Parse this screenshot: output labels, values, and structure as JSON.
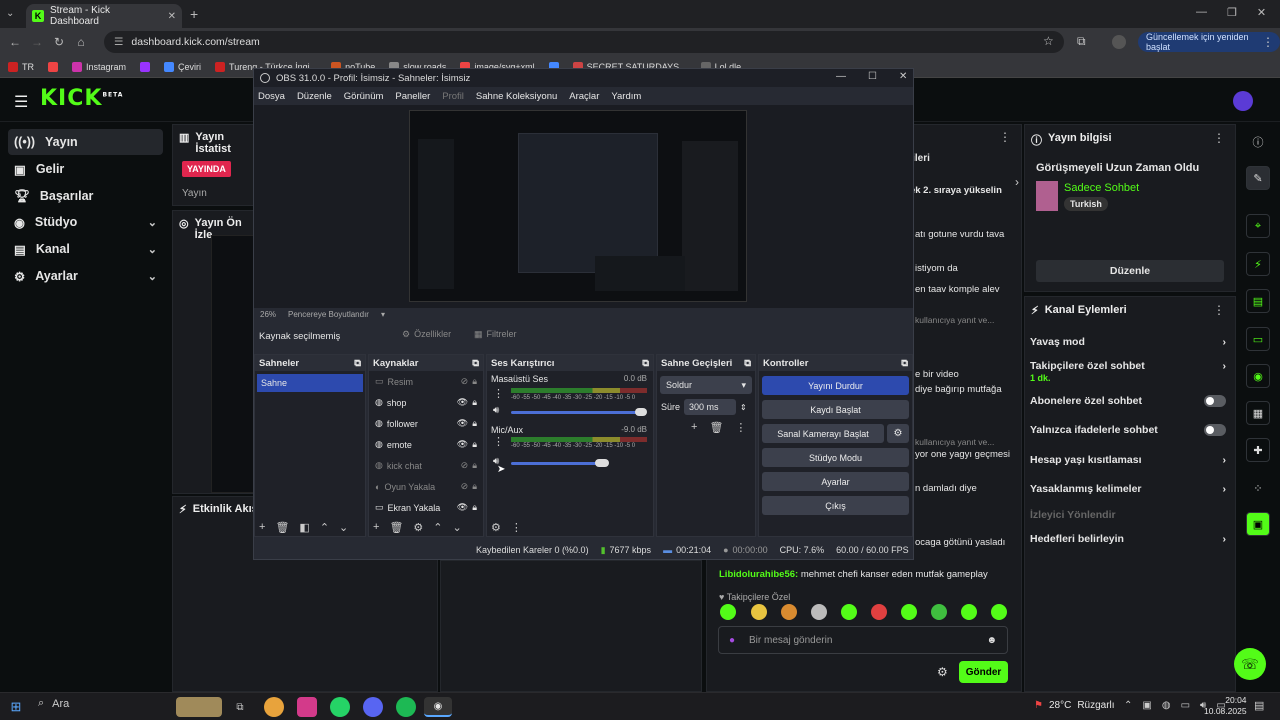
{
  "browser": {
    "tab_title": "Stream - Kick Dashboard",
    "url": "dashboard.kick.com/stream",
    "update_button": "Güncellemek için yeniden başlat",
    "bookmarks": [
      "TR",
      "",
      "Instagram",
      "",
      "Çeviri",
      "Tureng - Türkçe İngi...",
      "noTube",
      "slow roads",
      "image/svg+xml",
      "",
      "SECRET SATURDAYS...",
      "Lol dle"
    ]
  },
  "kick": {
    "logo": "KICK",
    "logo_sup": "BETA",
    "nav": [
      {
        "label": "Yayın",
        "icon": "broadcast-icon"
      },
      {
        "label": "Gelir",
        "icon": "revenue-icon"
      },
      {
        "label": "Başarılar",
        "icon": "trophy-icon"
      },
      {
        "label": "Stüdyo",
        "icon": "studio-icon"
      },
      {
        "label": "Kanal",
        "icon": "channel-icon"
      },
      {
        "label": "Ayarlar",
        "icon": "settings-icon"
      }
    ],
    "stats_panel": {
      "title": "Yayın İstatist",
      "badge": "YAYINDA",
      "label": "Yayın"
    },
    "preview_panel": {
      "title": "Yayın Ön İzle"
    },
    "activity_panel": {
      "title": "Etkinlik Akışı"
    },
    "chat_partial": {
      "header": "ecileri",
      "lines": [
        "erek 2. sıraya yükselin",
        "atı gotune vurdu tava",
        "istiyom da",
        "en taav komple alev",
        "kullanıcıya yanıt ve...",
        "e bir video",
        "diye bağırıp mutfağa",
        "kullanıcıya yanıt ve...",
        "yor one yagyı geçmesi",
        "n damladı diye",
        "ocaga götünü yasladı"
      ],
      "last_user": "Libidolurahibe56:",
      "last_message": "mehmet chefi kanser eden mutfak gameplay",
      "followers_only": "Takipçilere Özel",
      "input_placeholder": "Bir mesaj gönderin",
      "send": "Gönder"
    },
    "stream_info": {
      "title": "Yayın bilgisi",
      "stream_title": "Görüşmeyeli Uzun Zaman Oldu",
      "category": "Sadece Sohbet",
      "language": "Turkish",
      "edit_button": "Düzenle"
    },
    "channel_actions": {
      "title": "Kanal Eylemleri",
      "items": [
        {
          "label": "Yavaş mod",
          "kind": "chevron"
        },
        {
          "label": "Takipçilere özel sohbet",
          "sub": "1 dk.",
          "kind": "chevron"
        },
        {
          "label": "Abonelere özel sohbet",
          "kind": "toggle"
        },
        {
          "label": "Yalnızca ifadelerle sohbet",
          "kind": "toggle"
        },
        {
          "label": "Hesap yaşı kısıtlaması",
          "kind": "chevron"
        },
        {
          "label": "Yasaklanmış kelimeler",
          "kind": "chevron"
        },
        {
          "label": "İzleyici Yönlendir",
          "kind": "disabled"
        },
        {
          "label": "Hedefleri belirleyin",
          "kind": "chevron"
        }
      ]
    }
  },
  "obs": {
    "title": "OBS 31.0.0 - Profil: İsimsiz - Sahneler: İsimsiz",
    "menu": [
      "Dosya",
      "Düzenle",
      "Görünüm",
      "Paneller",
      "Profil",
      "Sahne Koleksiyonu",
      "Araçlar",
      "Yardım"
    ],
    "zoom": "26%",
    "fit": "Pencereye Boyutlandır",
    "no_source": "Kaynak seçilmemiş",
    "properties": "Özellikler",
    "filters": "Filtreler",
    "scenes": {
      "title": "Sahneler",
      "items": [
        "Sahne"
      ]
    },
    "sources": {
      "title": "Kaynaklar",
      "items": [
        "Resim",
        "shop",
        "follower",
        "emote",
        "kick chat",
        "Oyun Yakala",
        "Ekran Yakala"
      ]
    },
    "mixer": {
      "title": "Ses Karıştırıcı",
      "channels": [
        {
          "name": "Masaüstü Ses",
          "db": "0.0 dB"
        },
        {
          "name": "Mic/Aux",
          "db": "-9.0 dB"
        }
      ],
      "scale": "-60 -55 -50 -45 -40 -35 -30 -25 -20 -15 -10 -5 0"
    },
    "transitions": {
      "title": "Sahne Geçişleri",
      "type": "Soldur",
      "duration_label": "Süre",
      "duration": "300 ms"
    },
    "controls": {
      "title": "Kontroller",
      "buttons": [
        "Yayını Durdur",
        "Kaydı Başlat",
        "Sanal Kamerayı Başlat",
        "Stüdyo Modu",
        "Ayarlar",
        "Çıkış"
      ]
    },
    "status": {
      "dropped": "Kaybedilen Kareler 0 (%0.0)",
      "bitrate": "7677 kbps",
      "stream_time": "00:21:04",
      "rec_time": "00:00:00",
      "cpu": "CPU: 7.6%",
      "fps": "60.00 / 60.00 FPS"
    }
  },
  "taskbar": {
    "search": "Ara",
    "weather": "28°C",
    "wind": "Rüzgarlı",
    "time": "20:04",
    "date": "10.08.2025"
  },
  "colors": {
    "kick_green": "#53fc18",
    "live_red": "#e0264e",
    "obs_blue": "#2d4aae"
  }
}
